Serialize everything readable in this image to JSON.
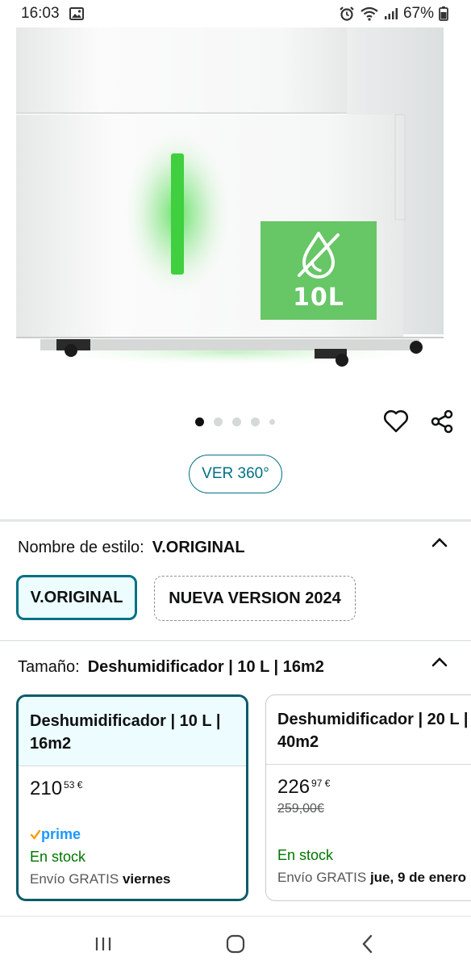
{
  "status_bar": {
    "time": "16:03",
    "battery": "67%",
    "icons": [
      "image-icon",
      "alarm-icon",
      "wifi-icon",
      "signal-icon",
      "battery-icon"
    ]
  },
  "product_image": {
    "badge_text": "10L",
    "badge_color": "#67c666",
    "light_color": "#4ad84a"
  },
  "carousel": {
    "total_dots": 5,
    "active_index": 0
  },
  "actions": {
    "icons": [
      "heart-icon",
      "share-icon"
    ]
  },
  "ver360": {
    "label": "VER 360°"
  },
  "style_section": {
    "label": "Nombre de estilo:",
    "value": "V.ORIGINAL",
    "options": [
      "V.ORIGINAL",
      "NUEVA VERSION 2024"
    ],
    "selected_index": 0
  },
  "size_section": {
    "label": "Tamaño:",
    "value": "Deshumidificador | 10 L | 16m2",
    "cards": [
      {
        "title_line1": "Deshumidificador | 10 L |",
        "title_line2": "16m2",
        "price_whole": "210",
        "price_cents": "53 €",
        "prime_label": "prime",
        "stock": "En stock",
        "delivery_prefix": "Envío GRATIS",
        "delivery_day": "viernes"
      },
      {
        "title_line1": "Deshumidificador | 20 L |",
        "title_line2": "40m2",
        "price_whole": "226",
        "price_cents": "97 €",
        "old_price": "259,00€",
        "stock": "En stock",
        "delivery_prefix": "Envío GRATIS",
        "delivery_day": "jue, 9 de enero"
      }
    ]
  },
  "colors": {
    "accent_teal": "#007185",
    "selected_border": "#0b5b69",
    "stock_green": "#007600",
    "prime_blue": "#1a98ff"
  },
  "nav_bar": {
    "icons": [
      "recents-icon",
      "home-icon",
      "back-icon"
    ]
  }
}
